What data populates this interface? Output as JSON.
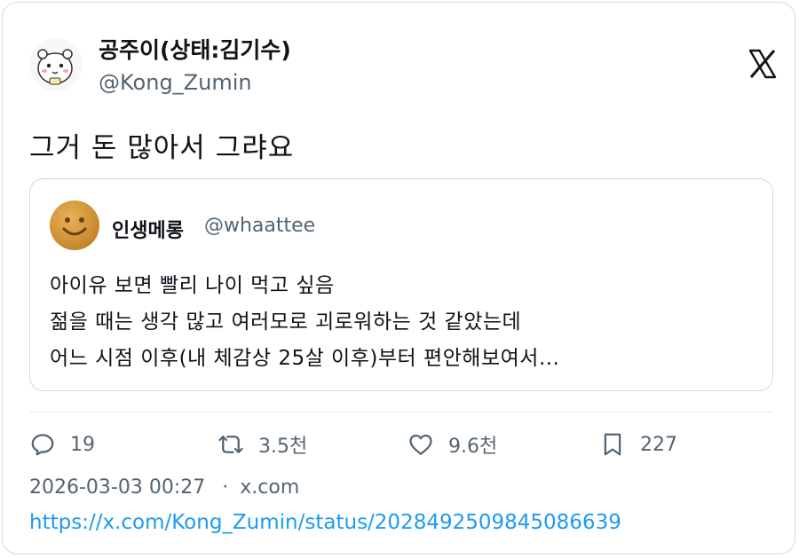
{
  "author": {
    "display_name": "공주이(상태:김기수)",
    "handle": "@Kong_Zumin",
    "avatar_icon": "hamster-avatar-icon"
  },
  "platform_icon": "x-logo-icon",
  "tweet": {
    "text": "그거 돈 많아서 그랴요"
  },
  "quoted_tweet": {
    "display_name": "인생메롱",
    "handle": "@whaattee",
    "avatar_icon": "smiley-potato-avatar-icon",
    "lines": [
      "아이유 보면 빨리 나이 먹고 싶음",
      "젊을 때는 생각 많고 여러모로 괴로워하는 것 같았는데",
      "어느 시점 이후(내 체감상 25살 이후)부터 편안해보여서..."
    ]
  },
  "actions": {
    "reply_count": "19",
    "retweet_count": "3.5천",
    "like_count": "9.6천",
    "bookmark_count": "227"
  },
  "meta": {
    "timestamp": "2026-03-03 00:27",
    "separator": "·",
    "source": "x.com"
  },
  "status_url": "https://x.com/Kong_Zumin/status/2028492509845086639",
  "colors": {
    "text": "#0f1419",
    "secondary": "#536471",
    "link": "#1d9bf0",
    "border": "#cfd9de"
  }
}
